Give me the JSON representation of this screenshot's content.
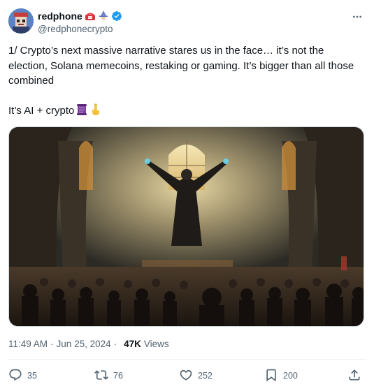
{
  "author": {
    "display_name": "redphone",
    "name_emoji": [
      "telephone-icon",
      "wizard-icon"
    ],
    "handle": "@redphonecrypto",
    "verified": true,
    "avatar": "pixel-art-avatar"
  },
  "tweet": {
    "paragraph_1": "1/ Crypto’s next massive narrative stares us in the face… it’s not the election, Solana memecoins, restaking or gaming. It’s bigger than all those combined",
    "paragraph_2": "It’s AI + crypto",
    "paragraph_2_emoji": [
      "scroll-icon",
      "pointing-down-icon"
    ],
    "media": "painting of a robed figure with raised arms in a cathedral before a large crowd"
  },
  "meta": {
    "time": "11:49 AM",
    "date": "Jun 25, 2024",
    "views_count": "47K",
    "views_label": "Views",
    "separator": "·"
  },
  "actions": {
    "replies": "35",
    "reposts": "76",
    "likes": "252",
    "bookmarks": "200"
  },
  "colors": {
    "text": "#0f1419",
    "secondary": "#536471",
    "verified": "#1d9bf0",
    "repost_green": "#536471"
  }
}
